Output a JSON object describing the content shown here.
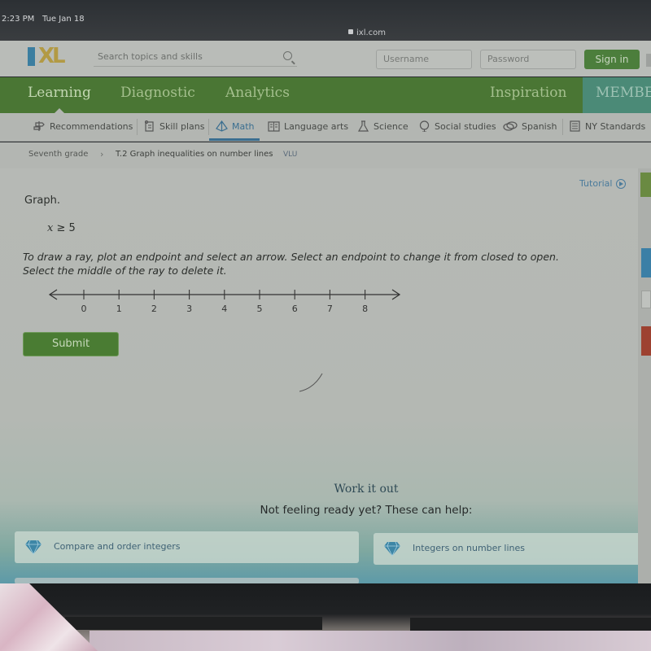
{
  "device": {
    "time": "2:23 PM",
    "date": "Tue Jan 18",
    "url": "ixl.com"
  },
  "header": {
    "logo_text": "XL",
    "search_placeholder": "Search topics and skills",
    "username_placeholder": "Username",
    "password_placeholder": "Password",
    "signin_label": "Sign in"
  },
  "main_nav": {
    "items": [
      {
        "label": "Learning",
        "active": true
      },
      {
        "label": "Diagnostic"
      },
      {
        "label": "Analytics"
      },
      {
        "label": "Inspiration"
      },
      {
        "label": "MEMBE"
      }
    ]
  },
  "sub_nav": {
    "items": [
      {
        "label": "Recommendations",
        "icon": "signpost-icon"
      },
      {
        "label": "Skill plans",
        "icon": "clipboard-icon"
      },
      {
        "label": "Math",
        "icon": "pyramid-icon",
        "active": true
      },
      {
        "label": "Language arts",
        "icon": "book-icon"
      },
      {
        "label": "Science",
        "icon": "flask-icon"
      },
      {
        "label": "Social studies",
        "icon": "globe-icon"
      },
      {
        "label": "Spanish",
        "icon": "speech-bubbles-icon"
      },
      {
        "label": "NY Standards",
        "icon": "standards-icon"
      }
    ]
  },
  "breadcrumb": {
    "grade": "Seventh grade",
    "skill": "T.2 Graph inequalities on number lines",
    "code": "VLU"
  },
  "question": {
    "tutorial_label": "Tutorial",
    "prompt": "Graph.",
    "inequality_var": "x",
    "inequality_rest": " ≥ 5",
    "instructions": "To draw a ray, plot an endpoint and select an arrow. Select an endpoint to change it from closed to open. Select the middle of the ray to delete it.",
    "number_line": {
      "ticks": [
        "0",
        "1",
        "2",
        "3",
        "4",
        "5",
        "6",
        "7",
        "8"
      ]
    },
    "submit_label": "Submit"
  },
  "work_it_out": {
    "title": "Work it out",
    "subtitle": "Not feeling ready yet? These can help:",
    "cards": [
      {
        "label": "Compare and order integers"
      },
      {
        "label": "Integers on number lines"
      }
    ]
  }
}
